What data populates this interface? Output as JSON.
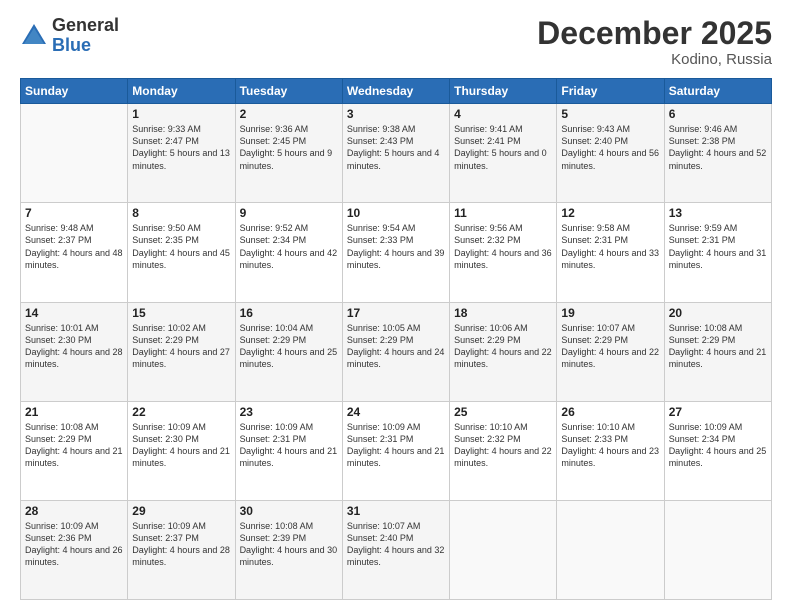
{
  "logo": {
    "general": "General",
    "blue": "Blue"
  },
  "header": {
    "month": "December 2025",
    "location": "Kodino, Russia"
  },
  "weekdays": [
    "Sunday",
    "Monday",
    "Tuesday",
    "Wednesday",
    "Thursday",
    "Friday",
    "Saturday"
  ],
  "weeks": [
    [
      null,
      {
        "day": 1,
        "sunrise": "9:33 AM",
        "sunset": "2:47 PM",
        "daylight": "5 hours and 13 minutes."
      },
      {
        "day": 2,
        "sunrise": "9:36 AM",
        "sunset": "2:45 PM",
        "daylight": "5 hours and 9 minutes."
      },
      {
        "day": 3,
        "sunrise": "9:38 AM",
        "sunset": "2:43 PM",
        "daylight": "5 hours and 4 minutes."
      },
      {
        "day": 4,
        "sunrise": "9:41 AM",
        "sunset": "2:41 PM",
        "daylight": "5 hours and 0 minutes."
      },
      {
        "day": 5,
        "sunrise": "9:43 AM",
        "sunset": "2:40 PM",
        "daylight": "4 hours and 56 minutes."
      },
      {
        "day": 6,
        "sunrise": "9:46 AM",
        "sunset": "2:38 PM",
        "daylight": "4 hours and 52 minutes."
      }
    ],
    [
      {
        "day": 7,
        "sunrise": "9:48 AM",
        "sunset": "2:37 PM",
        "daylight": "4 hours and 48 minutes."
      },
      {
        "day": 8,
        "sunrise": "9:50 AM",
        "sunset": "2:35 PM",
        "daylight": "4 hours and 45 minutes."
      },
      {
        "day": 9,
        "sunrise": "9:52 AM",
        "sunset": "2:34 PM",
        "daylight": "4 hours and 42 minutes."
      },
      {
        "day": 10,
        "sunrise": "9:54 AM",
        "sunset": "2:33 PM",
        "daylight": "4 hours and 39 minutes."
      },
      {
        "day": 11,
        "sunrise": "9:56 AM",
        "sunset": "2:32 PM",
        "daylight": "4 hours and 36 minutes."
      },
      {
        "day": 12,
        "sunrise": "9:58 AM",
        "sunset": "2:31 PM",
        "daylight": "4 hours and 33 minutes."
      },
      {
        "day": 13,
        "sunrise": "9:59 AM",
        "sunset": "2:31 PM",
        "daylight": "4 hours and 31 minutes."
      }
    ],
    [
      {
        "day": 14,
        "sunrise": "10:01 AM",
        "sunset": "2:30 PM",
        "daylight": "4 hours and 28 minutes."
      },
      {
        "day": 15,
        "sunrise": "10:02 AM",
        "sunset": "2:29 PM",
        "daylight": "4 hours and 27 minutes."
      },
      {
        "day": 16,
        "sunrise": "10:04 AM",
        "sunset": "2:29 PM",
        "daylight": "4 hours and 25 minutes."
      },
      {
        "day": 17,
        "sunrise": "10:05 AM",
        "sunset": "2:29 PM",
        "daylight": "4 hours and 24 minutes."
      },
      {
        "day": 18,
        "sunrise": "10:06 AM",
        "sunset": "2:29 PM",
        "daylight": "4 hours and 22 minutes."
      },
      {
        "day": 19,
        "sunrise": "10:07 AM",
        "sunset": "2:29 PM",
        "daylight": "4 hours and 22 minutes."
      },
      {
        "day": 20,
        "sunrise": "10:08 AM",
        "sunset": "2:29 PM",
        "daylight": "4 hours and 21 minutes."
      }
    ],
    [
      {
        "day": 21,
        "sunrise": "10:08 AM",
        "sunset": "2:29 PM",
        "daylight": "4 hours and 21 minutes."
      },
      {
        "day": 22,
        "sunrise": "10:09 AM",
        "sunset": "2:30 PM",
        "daylight": "4 hours and 21 minutes."
      },
      {
        "day": 23,
        "sunrise": "10:09 AM",
        "sunset": "2:31 PM",
        "daylight": "4 hours and 21 minutes."
      },
      {
        "day": 24,
        "sunrise": "10:09 AM",
        "sunset": "2:31 PM",
        "daylight": "4 hours and 21 minutes."
      },
      {
        "day": 25,
        "sunrise": "10:10 AM",
        "sunset": "2:32 PM",
        "daylight": "4 hours and 22 minutes."
      },
      {
        "day": 26,
        "sunrise": "10:10 AM",
        "sunset": "2:33 PM",
        "daylight": "4 hours and 23 minutes."
      },
      {
        "day": 27,
        "sunrise": "10:09 AM",
        "sunset": "2:34 PM",
        "daylight": "4 hours and 25 minutes."
      }
    ],
    [
      {
        "day": 28,
        "sunrise": "10:09 AM",
        "sunset": "2:36 PM",
        "daylight": "4 hours and 26 minutes."
      },
      {
        "day": 29,
        "sunrise": "10:09 AM",
        "sunset": "2:37 PM",
        "daylight": "4 hours and 28 minutes."
      },
      {
        "day": 30,
        "sunrise": "10:08 AM",
        "sunset": "2:39 PM",
        "daylight": "4 hours and 30 minutes."
      },
      {
        "day": 31,
        "sunrise": "10:07 AM",
        "sunset": "2:40 PM",
        "daylight": "4 hours and 32 minutes."
      },
      null,
      null,
      null
    ]
  ],
  "labels": {
    "sunrise_prefix": "Sunrise:",
    "sunset_prefix": "Sunset:",
    "daylight_prefix": "Daylight:"
  }
}
